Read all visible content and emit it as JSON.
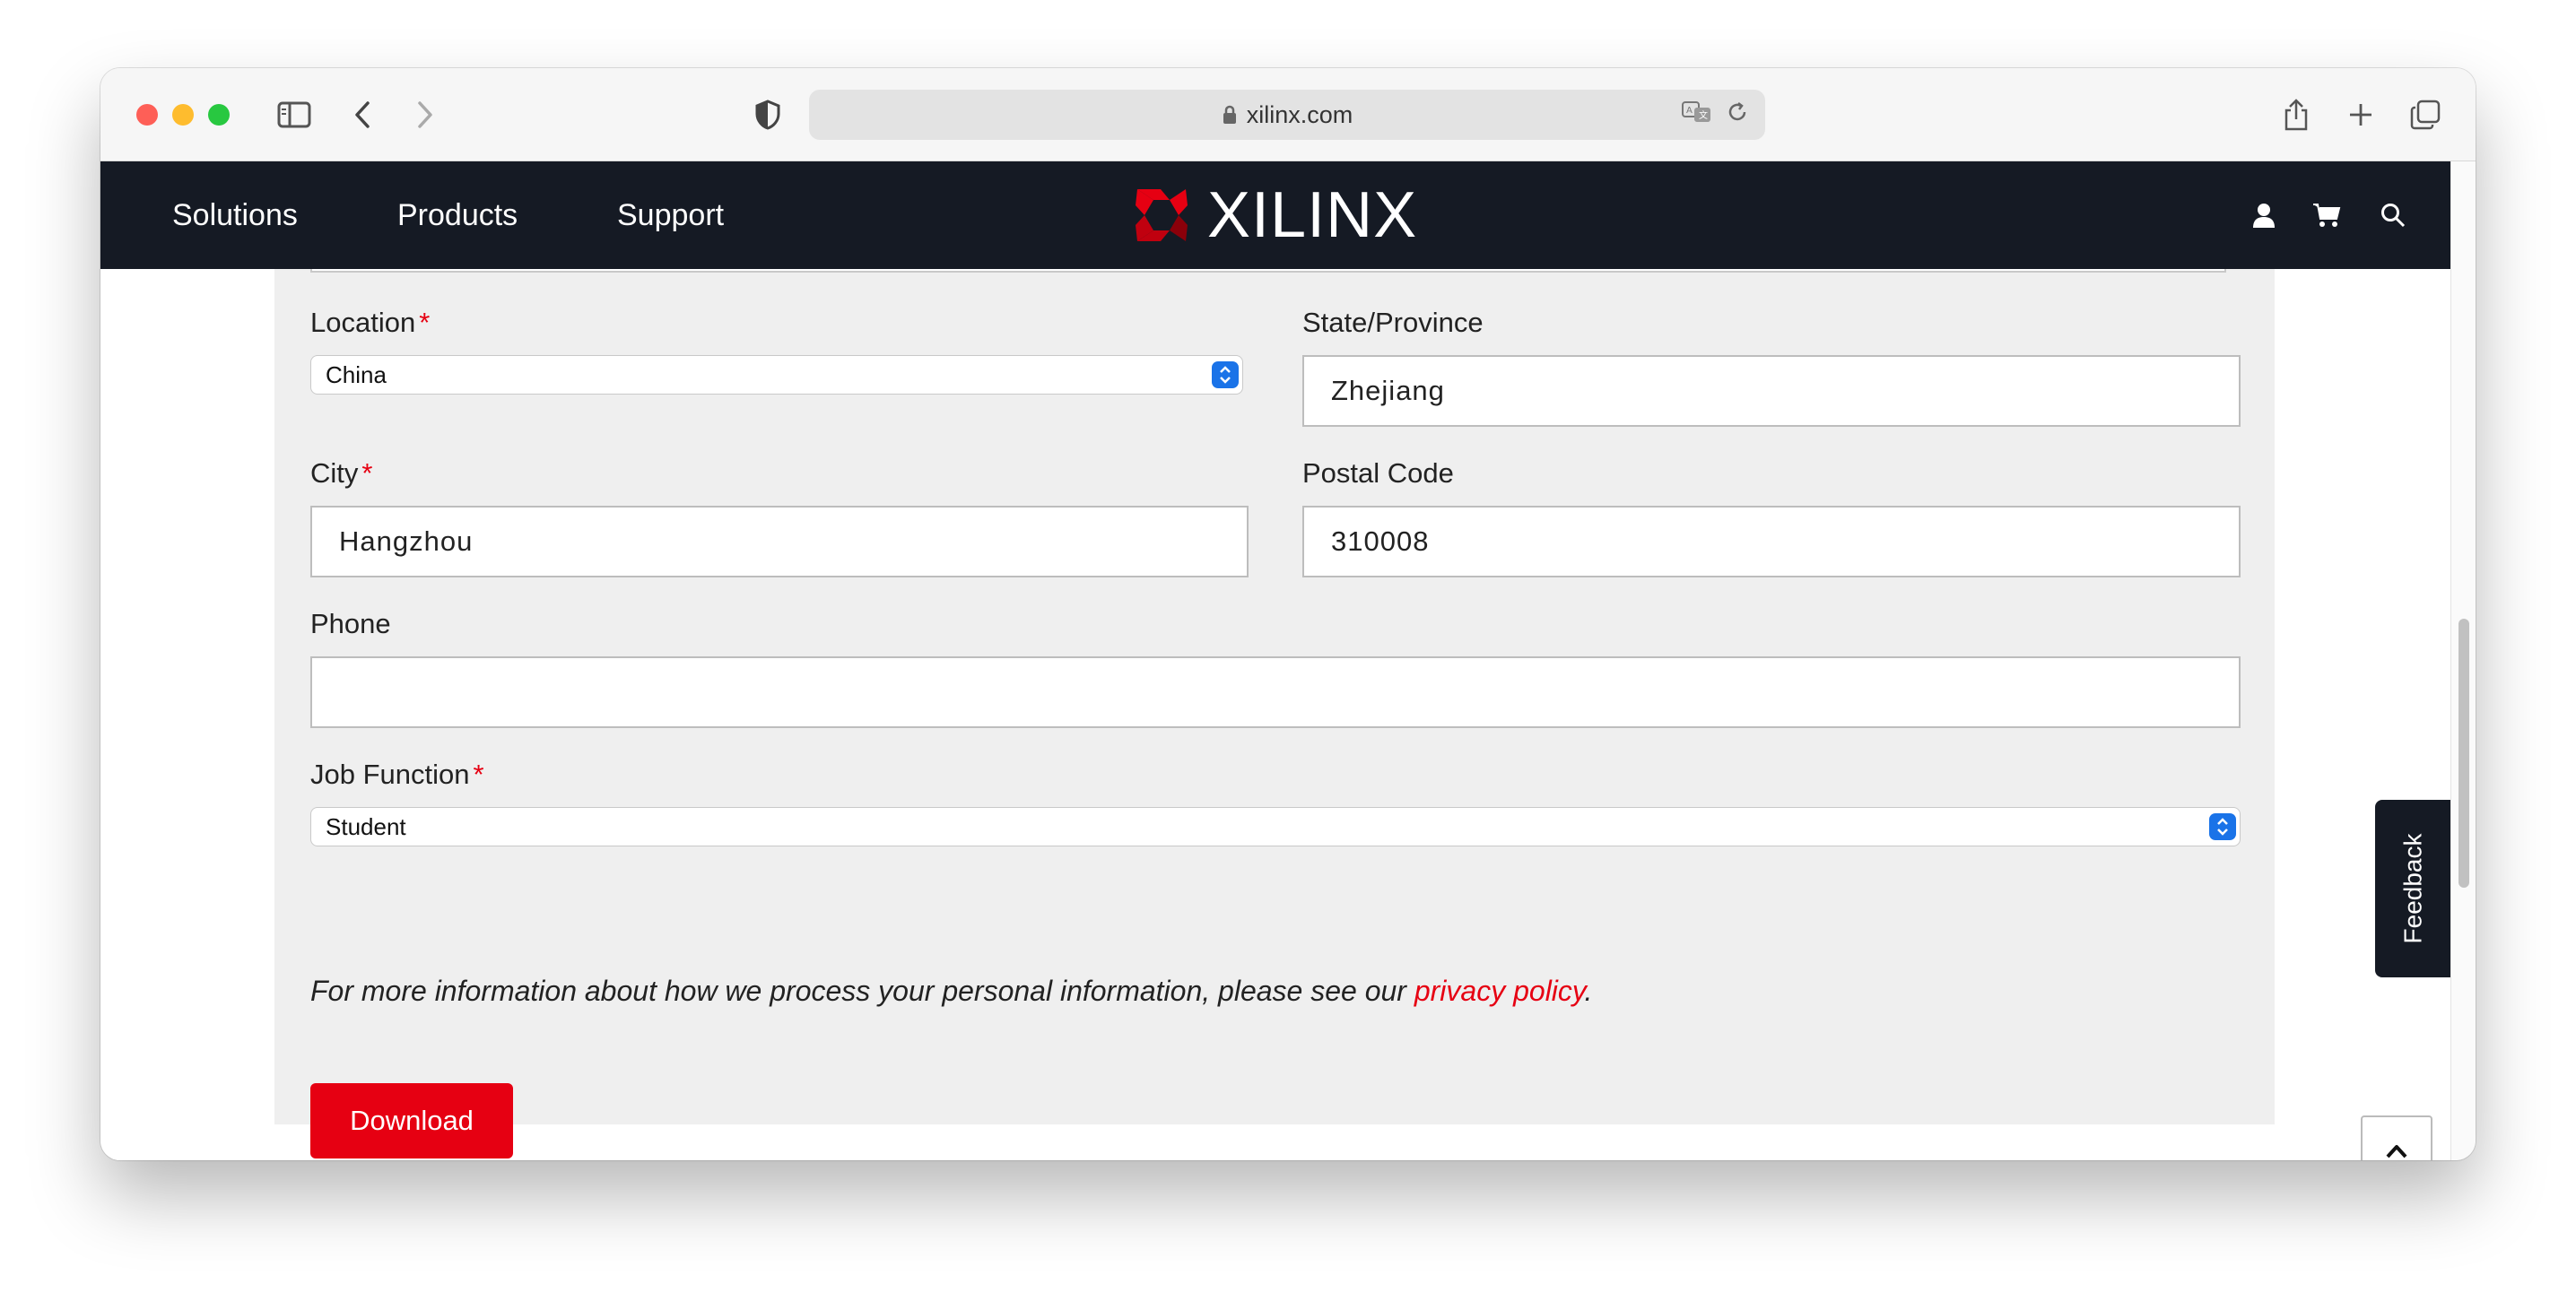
{
  "browser": {
    "url": "xilinx.com"
  },
  "nav": {
    "links": [
      "Solutions",
      "Products",
      "Support"
    ],
    "logo_text": "XILINX",
    "icons": [
      "user-icon",
      "cart-icon",
      "search-icon"
    ]
  },
  "form": {
    "location": {
      "label": "Location",
      "required": "*",
      "value": "China"
    },
    "state": {
      "label": "State/Province",
      "value": "Zhejiang"
    },
    "city": {
      "label": "City",
      "required": "*",
      "value": "Hangzhou"
    },
    "postal": {
      "label": "Postal Code",
      "value": "310008"
    },
    "phone": {
      "label": "Phone",
      "value": ""
    },
    "job": {
      "label": "Job Function",
      "required": "*",
      "value": "Student"
    },
    "info_text": "For more information about how we process your personal information, please see our ",
    "info_link": "privacy policy",
    "info_end": ".",
    "submit_label": "Download"
  },
  "feedback_label": "Feedback",
  "colors": {
    "accent": "#e60012",
    "nav_bg": "#151a24",
    "panel_bg": "#efefef"
  }
}
